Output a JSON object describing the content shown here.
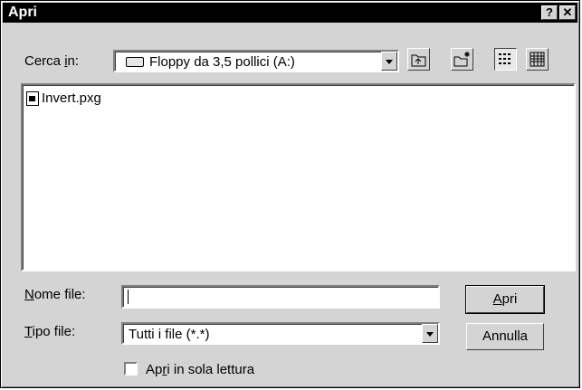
{
  "window": {
    "title": "Apri",
    "help_glyph": "?",
    "close_glyph": "✕"
  },
  "lookin": {
    "label_pre": "Cerca ",
    "label_u": "i",
    "label_post": "n:",
    "value": "Floppy da 3,5 pollici (A:)"
  },
  "files": [
    {
      "name": "Invert.pxg",
      "icon": "file-icon"
    }
  ],
  "filename": {
    "label_u": "N",
    "label_post": "ome file:",
    "value": ""
  },
  "filetype": {
    "label_u": "T",
    "label_post": "ipo file:",
    "value": "Tutti i file (*.*)"
  },
  "buttons": {
    "open_u": "A",
    "open_post": "pri",
    "cancel": "Annulla"
  },
  "readonly": {
    "label_pre": "Ap",
    "label_u": "r",
    "label_post": "i in sola lettura",
    "checked": false
  },
  "icons": [
    "drive-icon",
    "up-folder-icon",
    "new-folder-icon",
    "list-view-icon",
    "details-view-icon",
    "help-icon",
    "close-icon",
    "chevron-down-icon"
  ],
  "colors": {
    "face": "#d4d4d4",
    "titlebar": "#000000",
    "highlight": "#ffffff",
    "shadow": "#808080"
  }
}
